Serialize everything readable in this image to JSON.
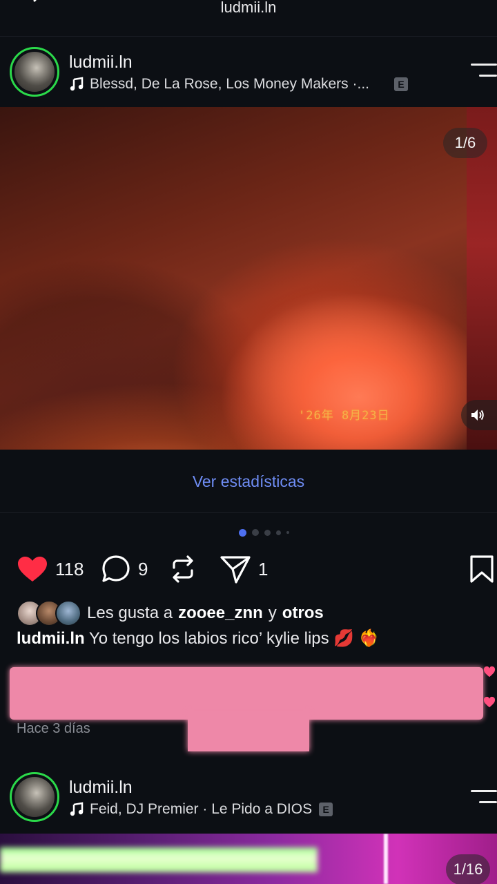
{
  "topbar": {
    "title": "ludmii.ln"
  },
  "post1": {
    "username": "ludmii.ln",
    "music": "Blessd, De La Rose, Los Money Makers ·...",
    "explicit": "E",
    "counter": "1/6",
    "stamp": "'26年 8月23日",
    "stats_link": "Ver estadísticas",
    "likes_count": "118",
    "comments_count": "9",
    "shares_count": "1",
    "liked_by_prefix": "Les gusta a",
    "liked_by_user": "zooee_znn",
    "liked_by_and": "y",
    "liked_by_others": "otros",
    "caption_user": "ludmii.ln",
    "caption_text": "Yo tengo los labios rico’  kylie lips 💋 ❤️‍🔥",
    "time": "Hace 3 días"
  },
  "post2": {
    "username": "ludmii.ln",
    "music": "Feid, DJ Premier · Le Pido a DIOS",
    "explicit": "E",
    "counter": "1/16"
  },
  "colors": {
    "accent": "#6f8df5",
    "story_ring": "#2bd94a",
    "like_red": "#ff2d45",
    "redaction": "#ee88a8"
  }
}
